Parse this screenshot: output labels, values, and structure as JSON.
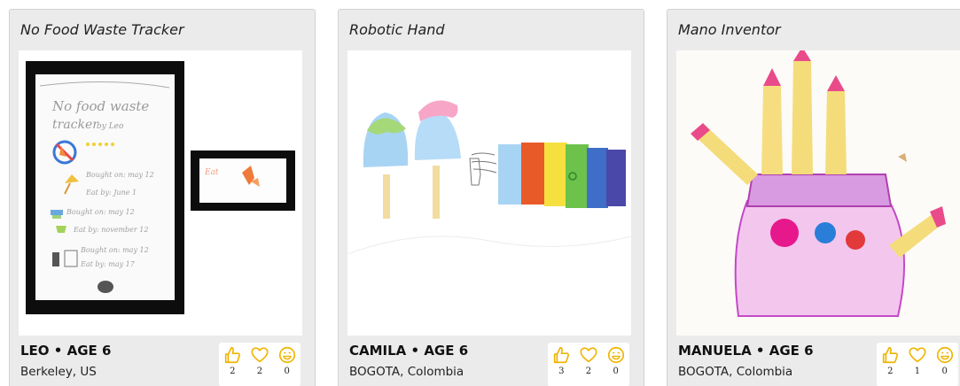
{
  "accent_color": "#f0b400",
  "cards": [
    {
      "title": "No Food Waste Tracker",
      "artwork_text": {
        "heading": "No food waste",
        "subheading": "tracker",
        "byline": "by Leo",
        "lines": [
          "Bought on: may 12",
          "Eat by: June 1",
          "Bought on: may 12",
          "Eat by: november 12",
          "Bought on: may 12",
          "Eat by: may 17"
        ],
        "side_text": "Eat"
      },
      "name": "LEO • AGE 6",
      "location": "Berkeley, US",
      "reactions": {
        "like": "2",
        "love": "2",
        "smile": "0"
      }
    },
    {
      "title": "Robotic Hand",
      "name": "CAMILA • AGE 6",
      "location": "BOGOTA, Colombia",
      "reactions": {
        "like": "3",
        "love": "2",
        "smile": "0"
      }
    },
    {
      "title": "Mano Inventor",
      "name": "MANUELA • AGE 6",
      "location": "BOGOTA, Colombia",
      "reactions": {
        "like": "2",
        "love": "1",
        "smile": "0"
      }
    }
  ]
}
